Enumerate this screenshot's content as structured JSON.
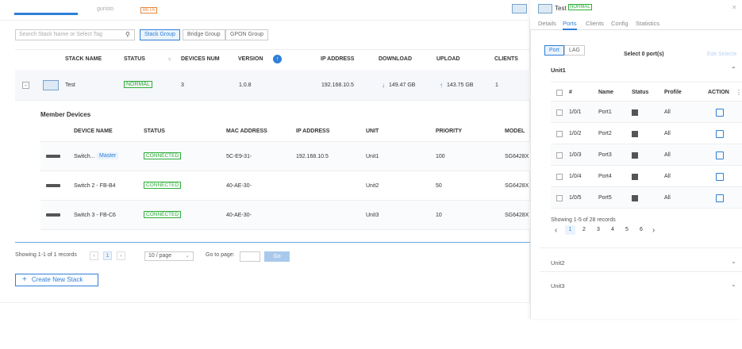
{
  "header": {
    "brand_text": "guristo",
    "beta_label": "BETA"
  },
  "search": {
    "placeholder": "Search Stack Name or Select Tag"
  },
  "group_tabs": [
    {
      "label": "Stack Group",
      "active": true
    },
    {
      "label": "Bridge Group",
      "active": false
    },
    {
      "label": "GPON Group",
      "active": false
    }
  ],
  "stack_table": {
    "headers": [
      "STACK NAME",
      "STATUS",
      "DEVICES NUM",
      "VERSION",
      "IP ADDRESS",
      "DOWNLOAD",
      "UPLOAD",
      "CLIENTS"
    ],
    "row": {
      "expander": "-",
      "name": "Test",
      "status": "NORMAL",
      "devices_num": "3",
      "version": "1.0.8",
      "ip": "192.168.10.5",
      "download": "149.47 GB",
      "upload": "143.75 GB",
      "clients": "1"
    }
  },
  "member_devices": {
    "title": "Member Devices",
    "headers": [
      "DEVICE NAME",
      "STATUS",
      "MAC ADDRESS",
      "IP ADDRESS",
      "UNIT",
      "PRIORITY",
      "MODEL"
    ],
    "rows": [
      {
        "name": "Switch...",
        "tag": "Master",
        "status": "CONNECTED",
        "mac": "5C-E9-31-",
        "ip": "192.168.10.5",
        "unit": "Unit1",
        "priority": "100",
        "model": "SG6428X"
      },
      {
        "name": "Switch 2 - FB-B4",
        "tag": "",
        "status": "CONNECTED",
        "mac": "40-AE-30-",
        "ip": "",
        "unit": "Unit2",
        "priority": "50",
        "model": "SG6428X"
      },
      {
        "name": "Switch 3 - FB-C6",
        "tag": "",
        "status": "CONNECTED",
        "mac": "40-AE-30-",
        "ip": "",
        "unit": "Unit3",
        "priority": "10",
        "model": "SG6428X"
      }
    ]
  },
  "pagination": {
    "summary": "Showing 1-1 of 1 records",
    "prev": "‹",
    "current": "1",
    "next": "›",
    "per_page": "10 / page",
    "goto_label": "Go to page:",
    "go_button": "Go"
  },
  "create_button": {
    "icon": "+",
    "label": "Create New Stack"
  },
  "panel": {
    "title": "Test",
    "status": "NORMAL",
    "tabs": [
      {
        "label": "Details",
        "active": false
      },
      {
        "label": "Ports",
        "active": true
      },
      {
        "label": "Clients",
        "active": false
      },
      {
        "label": "Config",
        "active": false
      },
      {
        "label": "Statistics",
        "active": false
      }
    ],
    "sub_tabs": [
      {
        "label": "Port",
        "active": true
      },
      {
        "label": "LAG",
        "active": false
      }
    ],
    "selected_text": "Select 0 port(s)",
    "edit_selected": "Edit Selecte",
    "unit1_label": "Unit1",
    "port_headers": [
      "#",
      "Name",
      "Status",
      "Profile",
      "ACTION"
    ],
    "ports": [
      {
        "num": "1/0/1",
        "name": "Port1",
        "profile": "All"
      },
      {
        "num": "1/0/2",
        "name": "Port2",
        "profile": "All"
      },
      {
        "num": "1/0/3",
        "name": "Port3",
        "profile": "All"
      },
      {
        "num": "1/0/4",
        "name": "Port4",
        "profile": "All"
      },
      {
        "num": "1/0/5",
        "name": "Port5",
        "profile": "All"
      }
    ],
    "port_summary": "Showing 1-5 of 28 records",
    "port_pages": [
      "1",
      "2",
      "3",
      "4",
      "5",
      "6"
    ],
    "port_prev": "‹",
    "port_next": "›",
    "unit2_label": "Unit2",
    "unit3_label": "Unit3"
  },
  "colors": {
    "accent": "#2f7fd8",
    "success": "#2fae3a",
    "beta": "#e8873a"
  }
}
